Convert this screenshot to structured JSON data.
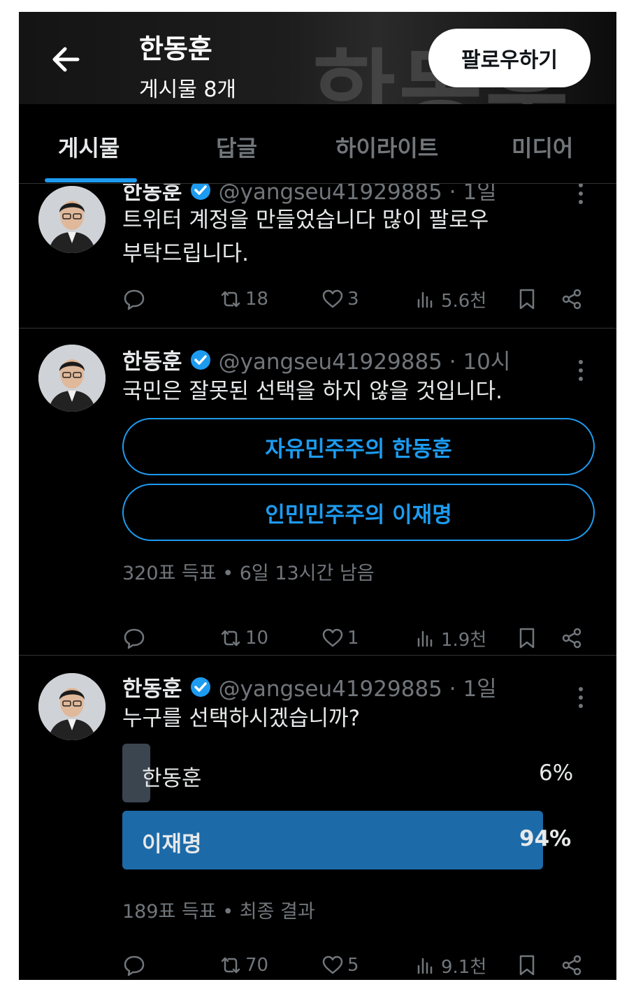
{
  "header": {
    "banner_text": "한동훈",
    "name": "한동훈",
    "post_count": "게시물 8개",
    "follow_label": "팔로우하기"
  },
  "tabs": [
    {
      "label": "게시물",
      "active": true
    },
    {
      "label": "답글",
      "active": false
    },
    {
      "label": "하이라이트",
      "active": false
    },
    {
      "label": "미디어",
      "active": false
    }
  ],
  "posts": [
    {
      "name": "한동훈",
      "handle": "@yangseu41929885 · 1일",
      "text_lines": [
        "트위터 계정을 만들었습니다 많이 팔로우",
        "부탁드립니다."
      ],
      "stats": {
        "retweets": "18",
        "likes": "3",
        "views": "5.6천"
      }
    },
    {
      "name": "한동훈",
      "handle": "@yangseu41929885 · 10시",
      "text_lines": [
        "국민은 잘못된 선택을 하지 않을 것입니다."
      ],
      "poll_options": [
        "자유민주주의 한동훈",
        "인민민주주의 이재명"
      ],
      "poll_meta": "320표 득표 • 6일 13시간 남음",
      "stats": {
        "retweets": "10",
        "likes": "1",
        "views": "1.9천"
      }
    },
    {
      "name": "한동훈",
      "handle": "@yangseu41929885 · 1일",
      "text_lines": [
        "누구를 선택하시겠습니까?"
      ],
      "poll_results": [
        {
          "label": "한동훈",
          "percent": "6%",
          "fraction": 0.06,
          "winner": false
        },
        {
          "label": "이재명",
          "percent": "94%",
          "fraction": 0.94,
          "winner": true
        }
      ],
      "poll_meta": "189표 득표 • 최종 결과",
      "stats": {
        "retweets": "70",
        "likes": "5",
        "views": "9.1천"
      }
    }
  ],
  "icons": {
    "back": "arrow-left-icon",
    "verified": "verified-badge-icon",
    "more": "more-vertical-icon",
    "reply": "reply-icon",
    "retweet": "retweet-icon",
    "like": "heart-icon",
    "views": "views-icon",
    "bookmark": "bookmark-icon",
    "share": "share-icon"
  },
  "colors": {
    "background": "#000000",
    "accent": "#1d9bf0",
    "muted": "#71767b",
    "winner_bar": "#1d6aa8",
    "loser_bar": "#3a4550",
    "follow_bg": "#ffffff"
  }
}
